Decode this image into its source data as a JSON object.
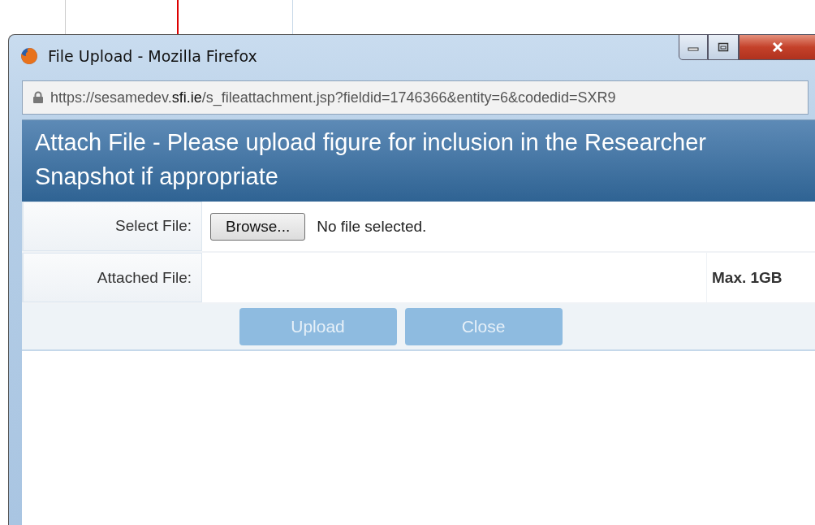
{
  "window": {
    "title": "File Upload - Mozilla Firefox"
  },
  "address_bar": {
    "url": "https://sesamedev.**sfi.ie**/s_fileattachment.jsp?fieldid=1746366&entity=6&codedid=SXR9"
  },
  "header": {
    "title": "Attach File - Please upload figure for inclusion in the Researcher Snapshot if appropriate"
  },
  "form": {
    "rows": [
      {
        "kind": "file",
        "label": "Select File:",
        "button": "Browse...",
        "status": "No file selected."
      },
      {
        "kind": "info",
        "label": "Attached File:",
        "note": "Max. 1GB"
      }
    ]
  },
  "buttons": [
    {
      "label": "Upload",
      "disabled": true
    },
    {
      "label": "Close",
      "disabled": true
    }
  ]
}
